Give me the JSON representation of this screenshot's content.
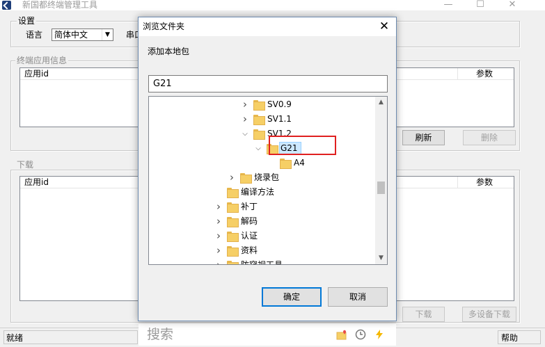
{
  "app": {
    "title": "新国都终端管理工具",
    "minimize": "—",
    "maximize": "☐",
    "close": "✕"
  },
  "settings": {
    "group_label": "设置",
    "language_label": "语言",
    "language_value": "简体中文",
    "serial_label": "串口"
  },
  "terminal_apps": {
    "group_label": "终端应用信息",
    "col_app_id": "应用id",
    "col_params": "参数",
    "refresh_button": "刷新",
    "delete_button": "删除"
  },
  "download": {
    "group_label": "下载",
    "col_app_id": "应用id",
    "col_params": "参数",
    "download_button": "下载",
    "multi_download_button": "多设备下载"
  },
  "status_bar": {
    "status": "就绪",
    "help": "帮助"
  },
  "dialog": {
    "title": "浏览文件夹",
    "close": "✕",
    "description": "添加本地包",
    "path_value": "G21",
    "ok_button": "确定",
    "cancel_button": "取消",
    "tree": [
      {
        "label": "SV0.9",
        "depth": 4,
        "expander": "collapsed"
      },
      {
        "label": "SV1.1",
        "depth": 4,
        "expander": "collapsed"
      },
      {
        "label": "SV1.2",
        "depth": 4,
        "expander": "expanded"
      },
      {
        "label": "G21",
        "depth": 5,
        "expander": "expanded",
        "selected": true
      },
      {
        "label": "A4",
        "depth": 6,
        "expander": "none"
      },
      {
        "label": "烧录包",
        "depth": 3,
        "expander": "collapsed"
      },
      {
        "label": "编译方法",
        "depth": 2,
        "expander": "none"
      },
      {
        "label": "补丁",
        "depth": 2,
        "expander": "collapsed"
      },
      {
        "label": "解码",
        "depth": 2,
        "expander": "collapsed"
      },
      {
        "label": "认证",
        "depth": 2,
        "expander": "collapsed"
      },
      {
        "label": "资料",
        "depth": 2,
        "expander": "collapsed"
      },
      {
        "label": "防窥视工具",
        "depth": 2,
        "expander": "collapsed"
      }
    ],
    "tree_scroll_position": 0.55
  },
  "ime": {
    "search_placeholder": "搜索",
    "icons": [
      "folder-heart-icon",
      "clock-icon",
      "lightning-icon"
    ]
  },
  "colors": {
    "accent": "#0078d7",
    "highlight_box": "#e02020",
    "folder": "#f6cf66",
    "selection": "#cce8ff"
  }
}
